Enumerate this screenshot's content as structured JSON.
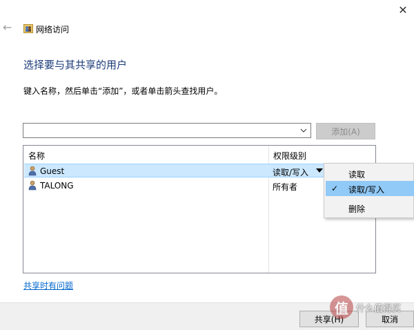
{
  "window": {
    "title": "网络访问",
    "close_icon": "close-icon"
  },
  "heading": "选择要与其共享的用户",
  "instruction": "键入名称，然后单击“添加”，或者单击箭头查找用户。",
  "name_input": {
    "value": "",
    "placeholder": ""
  },
  "add_button": "添加(A)",
  "list": {
    "columns": [
      "名称",
      "权限级别"
    ],
    "rows": [
      {
        "name": "Guest",
        "permission": "读取/写入",
        "selected": true
      },
      {
        "name": "TALONG",
        "permission": "所有者",
        "selected": false
      }
    ]
  },
  "permission_menu": {
    "items": [
      {
        "label": "读取",
        "checked": false
      },
      {
        "label": "读取/写入",
        "checked": true
      },
      {
        "label": "删除",
        "checked": false
      }
    ]
  },
  "help_link": "共享时有问题",
  "footer": {
    "share_button": "共享(H)",
    "cancel_button": "取消"
  },
  "watermark": {
    "logo_text": "值",
    "text": "什么值得买"
  },
  "colors": {
    "heading": "#1b3a78",
    "link": "#0066cc",
    "selection": "#cce8ff",
    "menu_highlight": "#91c9f7"
  }
}
